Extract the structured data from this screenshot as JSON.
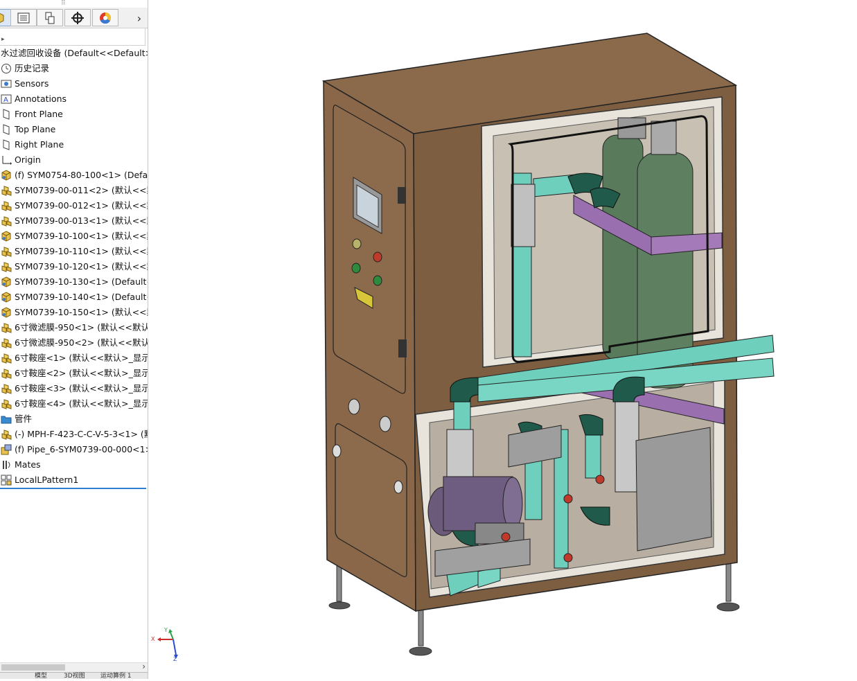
{
  "feature_manager": {
    "tabs": [
      {
        "name": "feature-manager-tab",
        "icon": "cube-icon"
      },
      {
        "name": "property-manager-tab",
        "icon": "property-list-icon"
      },
      {
        "name": "configuration-manager-tab",
        "icon": "configuration-icon"
      },
      {
        "name": "dimxpert-manager-tab",
        "icon": "crosshair-icon"
      },
      {
        "name": "display-manager-tab",
        "icon": "color-wheel-icon"
      }
    ],
    "more_arrow": "›",
    "tree": {
      "root_label": "水过滤回收设备  (Default<<Default>_A",
      "items": [
        {
          "label": "历史记录",
          "icon": "history-icon"
        },
        {
          "label": "Sensors",
          "icon": "sensors-icon"
        },
        {
          "label": "Annotations",
          "icon": "annotations-icon"
        },
        {
          "label": "Front Plane",
          "icon": "plane-icon"
        },
        {
          "label": "Top Plane",
          "icon": "plane-icon"
        },
        {
          "label": "Right Plane",
          "icon": "plane-icon"
        },
        {
          "label": "Origin",
          "icon": "origin-icon"
        },
        {
          "label": "(f) SYM0754-80-100<1> (Default",
          "icon": "part-icon"
        },
        {
          "label": "SYM0739-00-011<2> (默认<<默认",
          "icon": "assembly-icon"
        },
        {
          "label": "SYM0739-00-012<1> (默认<<默认",
          "icon": "assembly-icon"
        },
        {
          "label": "SYM0739-00-013<1> (默认<<默认",
          "icon": "assembly-icon"
        },
        {
          "label": "SYM0739-10-100<1> (默认<<默认",
          "icon": "part-icon"
        },
        {
          "label": "SYM0739-10-110<1> (默认<<默认",
          "icon": "assembly-icon"
        },
        {
          "label": "SYM0739-10-120<1> (默认<<默认",
          "icon": "assembly-icon"
        },
        {
          "label": "SYM0739-10-130<1> (Default<<",
          "icon": "part-icon"
        },
        {
          "label": "SYM0739-10-140<1> (Default<<",
          "icon": "part-icon"
        },
        {
          "label": "SYM0739-10-150<1> (默认<<默认",
          "icon": "part-icon"
        },
        {
          "label": "6寸微滤膜-950<1> (默认<<默认>",
          "icon": "assembly-icon"
        },
        {
          "label": "6寸微滤膜-950<2> (默认<<默认>",
          "icon": "assembly-icon"
        },
        {
          "label": "6寸鞍座<1> (默认<<默认>_显示状",
          "icon": "assembly-icon"
        },
        {
          "label": "6寸鞍座<2> (默认<<默认>_显示状",
          "icon": "assembly-icon"
        },
        {
          "label": "6寸鞍座<3> (默认<<默认>_显示状",
          "icon": "assembly-icon"
        },
        {
          "label": "6寸鞍座<4> (默认<<默认>_显示状",
          "icon": "assembly-icon"
        },
        {
          "label": "管件",
          "icon": "folder-icon"
        },
        {
          "label": "(-) MPH-F-423-C-C-V-5-3<1> (默",
          "icon": "assembly-icon"
        },
        {
          "label": "(f) Pipe_6-SYM0739-00-000<1> (",
          "icon": "pipe-icon"
        },
        {
          "label": "Mates",
          "icon": "mates-icon"
        },
        {
          "label": "LocalLPattern1",
          "icon": "pattern-icon"
        }
      ]
    },
    "bottom_tabs": [
      "模型",
      "3D视图",
      "运动算例 1"
    ]
  },
  "triad": {
    "x": "X",
    "y": "Y",
    "z": "Z"
  },
  "colors": {
    "cabinet": "#8b6a4a",
    "cabinet_dark": "#6a4f36",
    "membrane": "#5a7a5c",
    "pipe": "#6fcfbd",
    "bracket": "#9a6fb0",
    "accent_blue": "#2f7fd0"
  }
}
